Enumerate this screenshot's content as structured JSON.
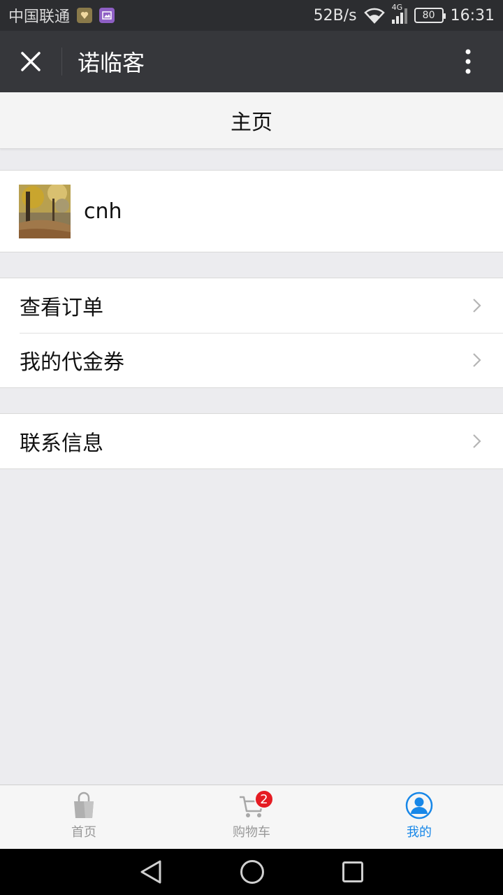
{
  "status_bar": {
    "carrier": "中国联通",
    "network_speed": "52B/s",
    "network_type": "4G",
    "battery": "80",
    "time": "16:31"
  },
  "title_bar": {
    "title": "诺临客",
    "close_icon": "close-icon",
    "more_icon": "more-vertical-icon"
  },
  "page_header": {
    "title": "主页"
  },
  "profile": {
    "username": "cnh"
  },
  "menu_group_1": [
    {
      "label": "查看订单"
    },
    {
      "label": "我的代金券"
    }
  ],
  "menu_group_2": [
    {
      "label": "联系信息"
    }
  ],
  "tab_bar": {
    "tabs": [
      {
        "label": "首页",
        "icon": "shopping-bag-icon",
        "active": false
      },
      {
        "label": "购物车",
        "icon": "cart-icon",
        "active": false,
        "badge": "2"
      },
      {
        "label": "我的",
        "icon": "user-icon",
        "active": true
      }
    ]
  },
  "colors": {
    "accent": "#1787e8",
    "badge": "#e51c23",
    "title_bar": "#36373b",
    "background": "#ececef"
  }
}
